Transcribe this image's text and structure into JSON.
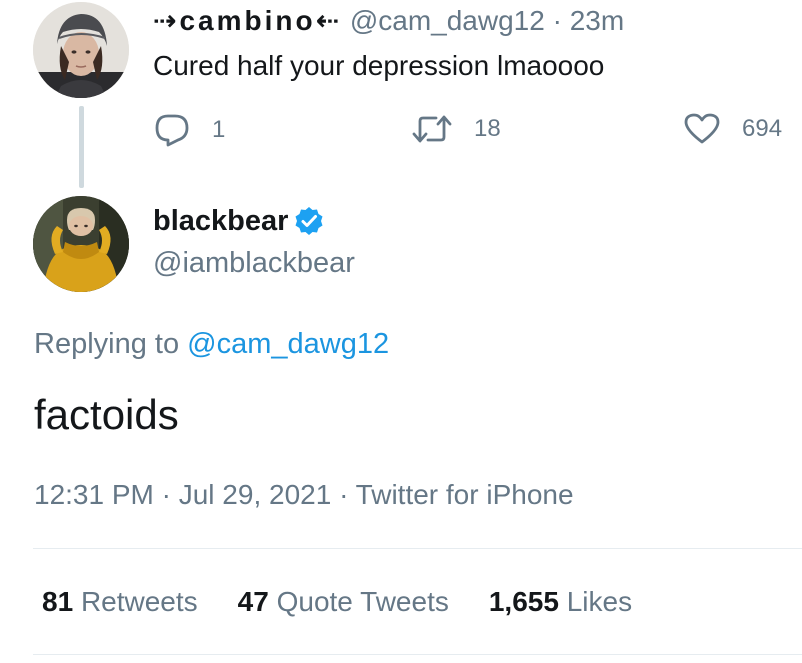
{
  "parent_tweet": {
    "display_name": "⇢cambino⇠",
    "handle": "@cam_dawg12",
    "separator": "·",
    "time_ago": "23m",
    "text": "Cured half your depression lmaoooo",
    "replies": "1",
    "retweets": "18",
    "likes": "694",
    "icons": {
      "reply": "reply-icon",
      "retweet": "retweet-icon",
      "like": "heart-icon"
    }
  },
  "main_tweet": {
    "display_name": "blackbear",
    "verified": true,
    "handle": "@iamblackbear",
    "replying_prefix": "Replying to ",
    "replying_handle": "@cam_dawg12",
    "text": "factoids",
    "timestamp": "12:31 PM · Jul 29, 2021 · Twitter for iPhone"
  },
  "stats": {
    "retweets_count": "81",
    "retweets_label": "Retweets",
    "quote_count": "47",
    "quote_label": "Quote Tweets",
    "likes_count": "1,655",
    "likes_label": "Likes"
  },
  "colors": {
    "text": "#14171a",
    "secondary": "#657786",
    "link": "#1b95e0",
    "verified": "#1da1f2",
    "divider": "#e6ecf0",
    "thread_line": "#cfd9de"
  }
}
